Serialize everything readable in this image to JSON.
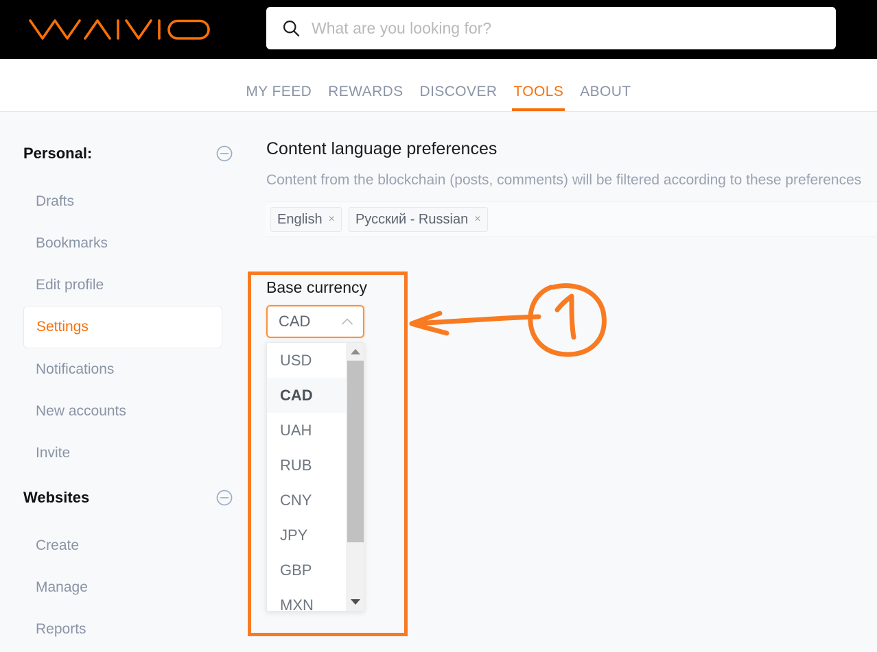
{
  "header": {
    "logo_text": "WAIVIO",
    "logo_color": "#f87007",
    "search": {
      "icon": "search-icon",
      "placeholder": "What are you looking for?",
      "value": ""
    }
  },
  "nav": {
    "items": [
      {
        "label": "MY FEED",
        "active": false
      },
      {
        "label": "REWARDS",
        "active": false
      },
      {
        "label": "DISCOVER",
        "active": false
      },
      {
        "label": "TOOLS",
        "active": true
      },
      {
        "label": "ABOUT",
        "active": false
      }
    ],
    "active_color": "#f87007",
    "inactive_color": "#8a94a6"
  },
  "sidebar": {
    "groups": [
      {
        "title": "Personal:",
        "collapse_icon": "minus-circle-icon",
        "items": [
          {
            "label": "Drafts",
            "active": false
          },
          {
            "label": "Bookmarks",
            "active": false
          },
          {
            "label": "Edit profile",
            "active": false
          },
          {
            "label": "Settings",
            "active": true
          },
          {
            "label": "Notifications",
            "active": false
          },
          {
            "label": "New accounts",
            "active": false
          },
          {
            "label": "Invite",
            "active": false
          }
        ]
      },
      {
        "title": "Websites",
        "collapse_icon": "minus-circle-icon",
        "items": [
          {
            "label": "Create",
            "active": false
          },
          {
            "label": "Manage",
            "active": false
          },
          {
            "label": "Reports",
            "active": false
          }
        ]
      }
    ]
  },
  "content": {
    "language_section": {
      "title": "Content language preferences",
      "description": "Content from the blockchain (posts, comments) will be filtered according to these preferences",
      "tags": [
        {
          "label": "English",
          "remove": "×"
        },
        {
          "label": "Русский - Russian",
          "remove": "×"
        }
      ]
    },
    "currency_section": {
      "label": "Base currency",
      "selected": "CAD",
      "chevron": "chevron-up-icon",
      "expanded": true,
      "options": [
        {
          "label": "USD",
          "selected": false
        },
        {
          "label": "CAD",
          "selected": true
        },
        {
          "label": "UAH",
          "selected": false
        },
        {
          "label": "RUB",
          "selected": false
        },
        {
          "label": "CNY",
          "selected": false
        },
        {
          "label": "JPY",
          "selected": false
        },
        {
          "label": "GBP",
          "selected": false
        },
        {
          "label": "MXN",
          "selected": false
        }
      ],
      "scrollbar": {
        "up_arrow": "scroll-up-arrow-icon",
        "down_arrow": "scroll-down-arrow-icon"
      }
    }
  },
  "annotation": {
    "color": "#f87b22",
    "badge_label": "1",
    "shapes": [
      "highlight-rectangle",
      "pointer-arrow",
      "circled-number"
    ]
  }
}
